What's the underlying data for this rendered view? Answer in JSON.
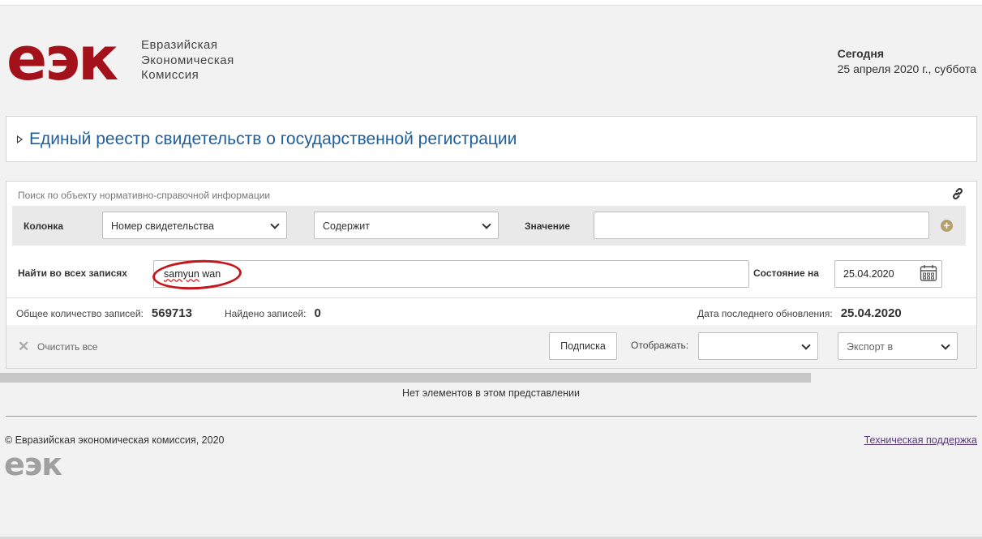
{
  "header": {
    "logo_text": "еэк",
    "org_name_lines": [
      "Евразийская",
      "Экономическая",
      "Комиссия"
    ],
    "today_label": "Сегодня",
    "today_date": "25 апреля 2020 г., суббота"
  },
  "page_title": "Единый реестр свидетельств о государственной регистрации",
  "search_panel": {
    "hint": "Поиск по объекту нормативно-справочной информации",
    "column_label": "Колонка",
    "column_value": "Номер свидетельства",
    "operator_value": "Содержит",
    "value_label": "Значение",
    "value_input": "",
    "find_all_label": "Найти во всех записях",
    "find_all_value_part1": "samyun",
    "find_all_value_part2": " wan",
    "state_label": "Состояние на",
    "state_date": "25.04.2020"
  },
  "stats": {
    "total_label": "Общее количество записей:",
    "total_value": "569713",
    "found_label": "Найдено записей:",
    "found_value": "0",
    "updated_label": "Дата последнего обновления:",
    "updated_value": "25.04.2020"
  },
  "toolbar": {
    "clear_label": "Очистить все",
    "subscribe_label": "Подписка",
    "show_label": "Отображать:",
    "show_value": "",
    "export_placeholder": "Экспорт в"
  },
  "empty_message": "Нет элементов в этом представлении",
  "footer": {
    "copyright": "© Евразийская экономическая комиссия, 2020",
    "logo_text": "еэк",
    "support_link": "Техническая поддержка"
  },
  "colors": {
    "brand_red": "#a3121a",
    "title_blue": "#1f5e9c",
    "annotation_red": "#c4161c"
  }
}
